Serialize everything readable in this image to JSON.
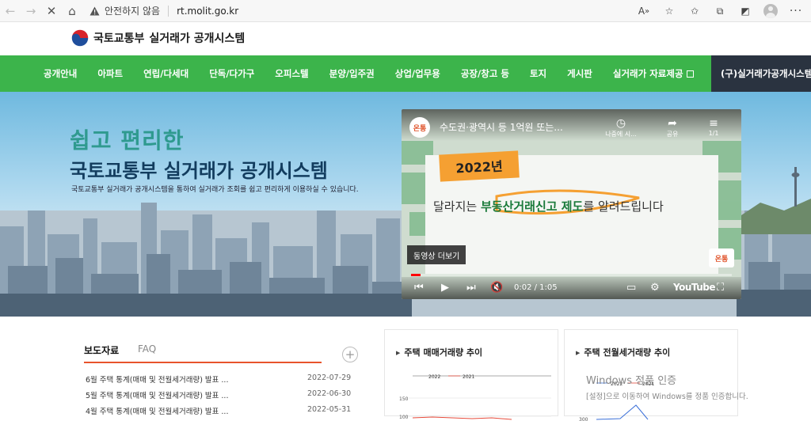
{
  "browser": {
    "security_label": "안전하지 않음",
    "url": "rt.molit.go.kr"
  },
  "site": {
    "ministry": "국토교통부",
    "system": "실거래가 공개시스템"
  },
  "nav": {
    "items": [
      "공개안내",
      "아파트",
      "연립/다세대",
      "단독/다가구",
      "오피스텔",
      "분양/입주권",
      "상업/업무용",
      "공장/창고 등",
      "토지",
      "게시판",
      "실거래가 자료제공"
    ],
    "special": "(구)실거래가공개시스템"
  },
  "hero": {
    "tagline": "쉽고 편리한",
    "title": "국토교통부 실거래가 공개시스템",
    "description": "국토교통부 실거래가 공개시스템을 통하여 실거래가 조회를 쉽고 편리하게 이용하실 수 있습니다."
  },
  "video": {
    "title": "수도권·광역시 등 1억원 또는...",
    "later_label": "나중에 시...",
    "share_label": "공유",
    "playlist_label": "1/1",
    "year": "2022년",
    "headline_pre": "달라지는 ",
    "headline_bold": "부동산거래신고 제도",
    "headline_post": "를 알려드립니다",
    "more_label": "동영상 더보기",
    "time": "0:02 / 1:05",
    "progress": 0.03,
    "brand": "YouTube",
    "channel_badge": "온통"
  },
  "news": {
    "tab_active": "보도자료",
    "tab_inactive": "FAQ",
    "rows": [
      {
        "title": "6월 주택 통계(매매 및 전월세거래량) 발표 ...",
        "date": "2022-07-29"
      },
      {
        "title": "5월 주택 통계(매매 및 전월세거래량) 발표 ...",
        "date": "2022-06-30"
      },
      {
        "title": "4월 주택 통계(매매 및 전월세거래량) 발표 ...",
        "date": "2022-05-31"
      }
    ]
  },
  "charts": [
    {
      "title": "주택 매매거래량 추이",
      "legend": [
        "2022",
        "2021"
      ],
      "ticks": [
        "150",
        "100"
      ]
    },
    {
      "title": "주택 전월세거래량 추이",
      "legend": [
        "2022",
        "2021"
      ],
      "ticks": [
        "300"
      ]
    }
  ],
  "watermark": {
    "line1": "Windows 정품 인증",
    "line2": "[설정]으로 이동하여 Windows를 정품 인증합니다."
  },
  "colors": {
    "nav_green": "#3cb44b",
    "nav_special": "#2a3340",
    "accent_orange": "#e8532b",
    "hero_teal": "#2f9a8f"
  }
}
